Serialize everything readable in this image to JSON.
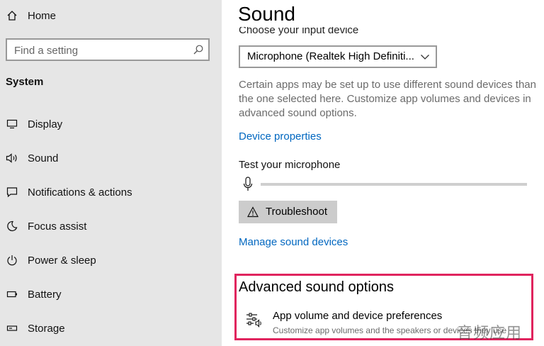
{
  "sidebar": {
    "home_label": "Home",
    "search_placeholder": "Find a setting",
    "section_title": "System",
    "items": [
      {
        "label": "Display",
        "icon": "monitor-icon"
      },
      {
        "label": "Sound",
        "icon": "speaker-icon"
      },
      {
        "label": "Notifications & actions",
        "icon": "notification-icon"
      },
      {
        "label": "Focus assist",
        "icon": "moon-icon"
      },
      {
        "label": "Power & sleep",
        "icon": "power-icon"
      },
      {
        "label": "Battery",
        "icon": "battery-icon"
      },
      {
        "label": "Storage",
        "icon": "storage-icon"
      }
    ]
  },
  "main": {
    "title": "Sound",
    "input_label": "Choose your input device",
    "input_device": "Microphone (Realtek High Definiti...",
    "description": "Certain apps may be set up to use different sound devices than the one selected here. Customize app volumes and devices in advanced sound options.",
    "device_properties": "Device properties",
    "test_label": "Test your microphone",
    "troubleshoot": "Troubleshoot",
    "manage_devices": "Manage sound devices",
    "advanced": {
      "title": "Advanced sound options",
      "item_title": "App volume and device preferences",
      "item_sub": "Customize app volumes and the speakers or devices they use"
    }
  },
  "watermark": "音频应用",
  "colors": {
    "sidebar_bg": "#e6e6e6",
    "link": "#0067c0",
    "highlight_border": "#e0245e",
    "button_bg": "#cccccc"
  }
}
